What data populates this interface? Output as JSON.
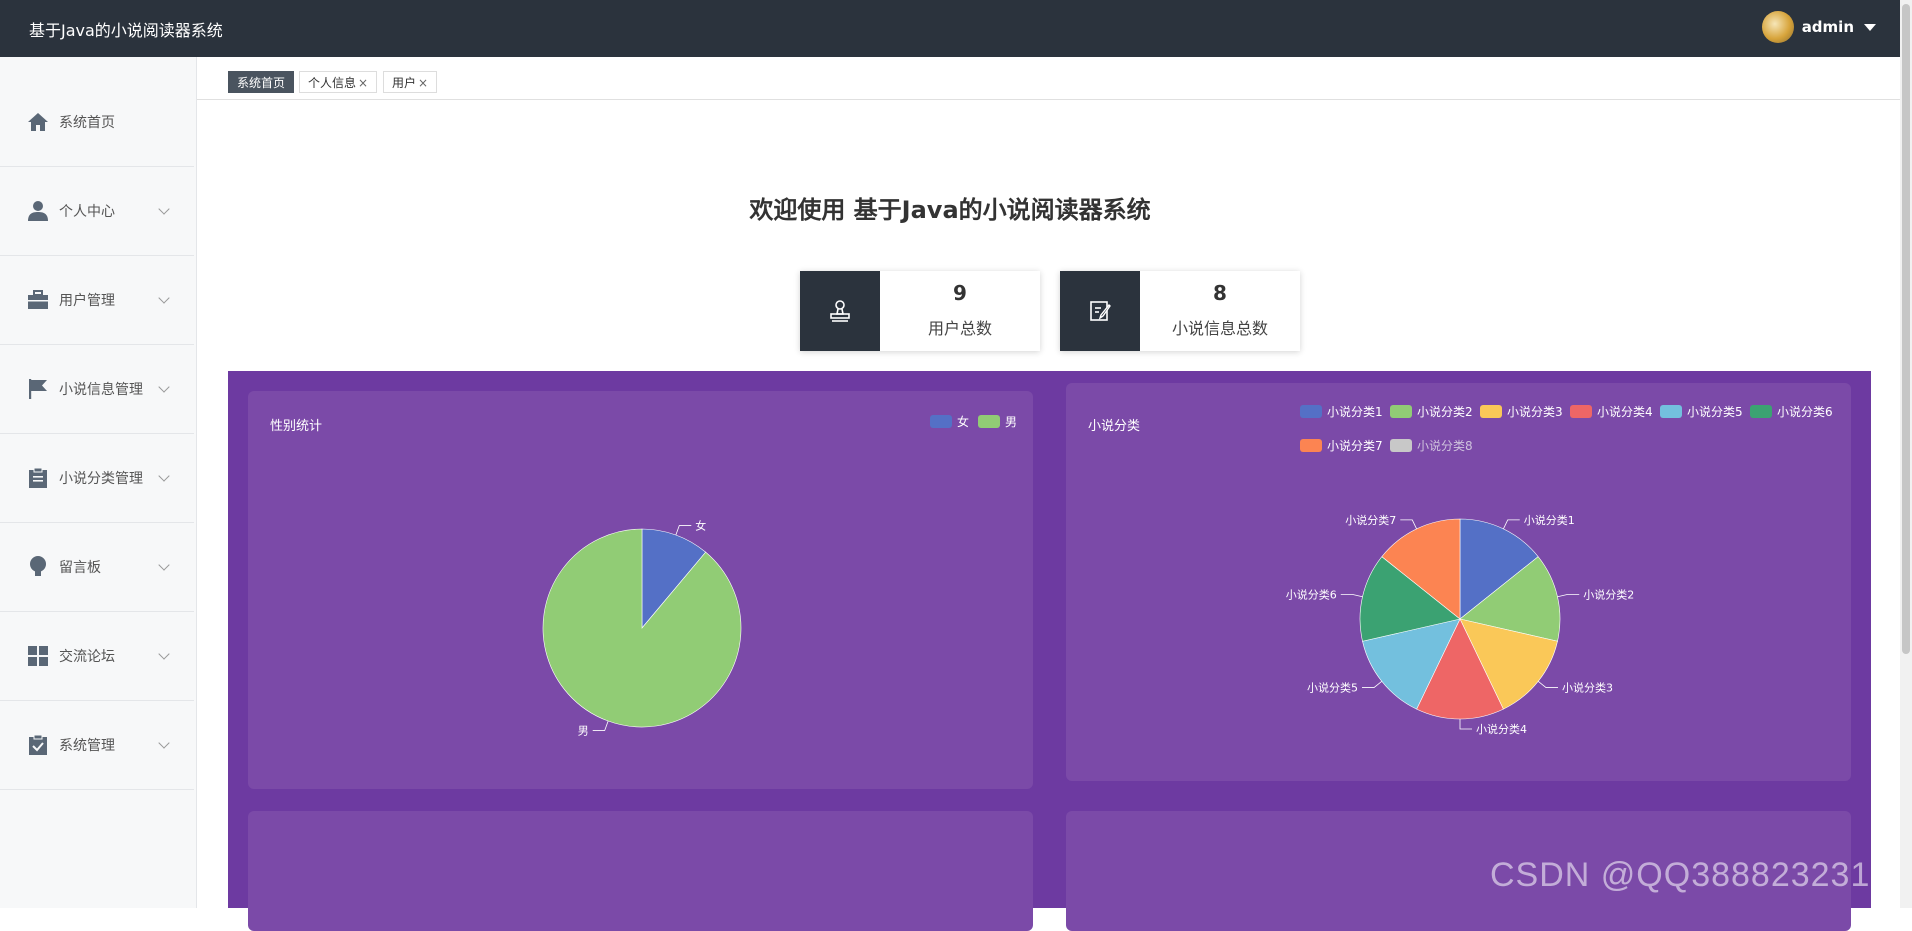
{
  "app": {
    "title": "基于Java的小说阅读器系统",
    "username": "admin"
  },
  "sidebar": {
    "items": [
      {
        "label": "系统首页",
        "icon": "home-icon",
        "expandable": false
      },
      {
        "label": "个人中心",
        "icon": "user-icon",
        "expandable": true
      },
      {
        "label": "用户管理",
        "icon": "briefcase-icon",
        "expandable": true
      },
      {
        "label": "小说信息管理",
        "icon": "flag-icon",
        "expandable": true
      },
      {
        "label": "小说分类管理",
        "icon": "clipboard-icon",
        "expandable": true
      },
      {
        "label": "留言板",
        "icon": "bulb-icon",
        "expandable": true
      },
      {
        "label": "交流论坛",
        "icon": "grid-icon",
        "expandable": true
      },
      {
        "label": "系统管理",
        "icon": "clipboard-check-icon",
        "expandable": true
      }
    ]
  },
  "tabs": [
    {
      "label": "系统首页",
      "active": true,
      "closable": false
    },
    {
      "label": "个人信息",
      "active": false,
      "closable": true
    },
    {
      "label": "用户",
      "active": false,
      "closable": true
    }
  ],
  "tab_close_glyph": "×",
  "main": {
    "welcome": "欢迎使用 基于Java的小说阅读器系统",
    "stats": [
      {
        "value": "9",
        "label": "用户总数",
        "icon": "stamp-icon"
      },
      {
        "value": "8",
        "label": "小说信息总数",
        "icon": "edit-note-icon"
      }
    ]
  },
  "colors": {
    "topbar": "#2b333d",
    "panel_bg": "#6d3aa1",
    "card_bg": "#7b4aa8",
    "palette": [
      "#5470c6",
      "#91cc75",
      "#fac858",
      "#ee6666",
      "#73c0de",
      "#3ba272",
      "#fc8452",
      "#c8c8c8"
    ]
  },
  "watermark": "CSDN @QQ3888232316",
  "chart_data": [
    {
      "type": "pie",
      "title": "性别统计",
      "categories": [
        "女",
        "男"
      ],
      "values": [
        1,
        8
      ],
      "legend": "top-right"
    },
    {
      "type": "pie",
      "title": "小说分类",
      "categories": [
        "小说分类1",
        "小说分类2",
        "小说分类3",
        "小说分类4",
        "小说分类5",
        "小说分类6",
        "小说分类7",
        "小说分类8"
      ],
      "values": [
        1,
        1,
        1,
        1,
        1,
        1,
        1,
        0
      ],
      "legend": "top-right"
    }
  ]
}
